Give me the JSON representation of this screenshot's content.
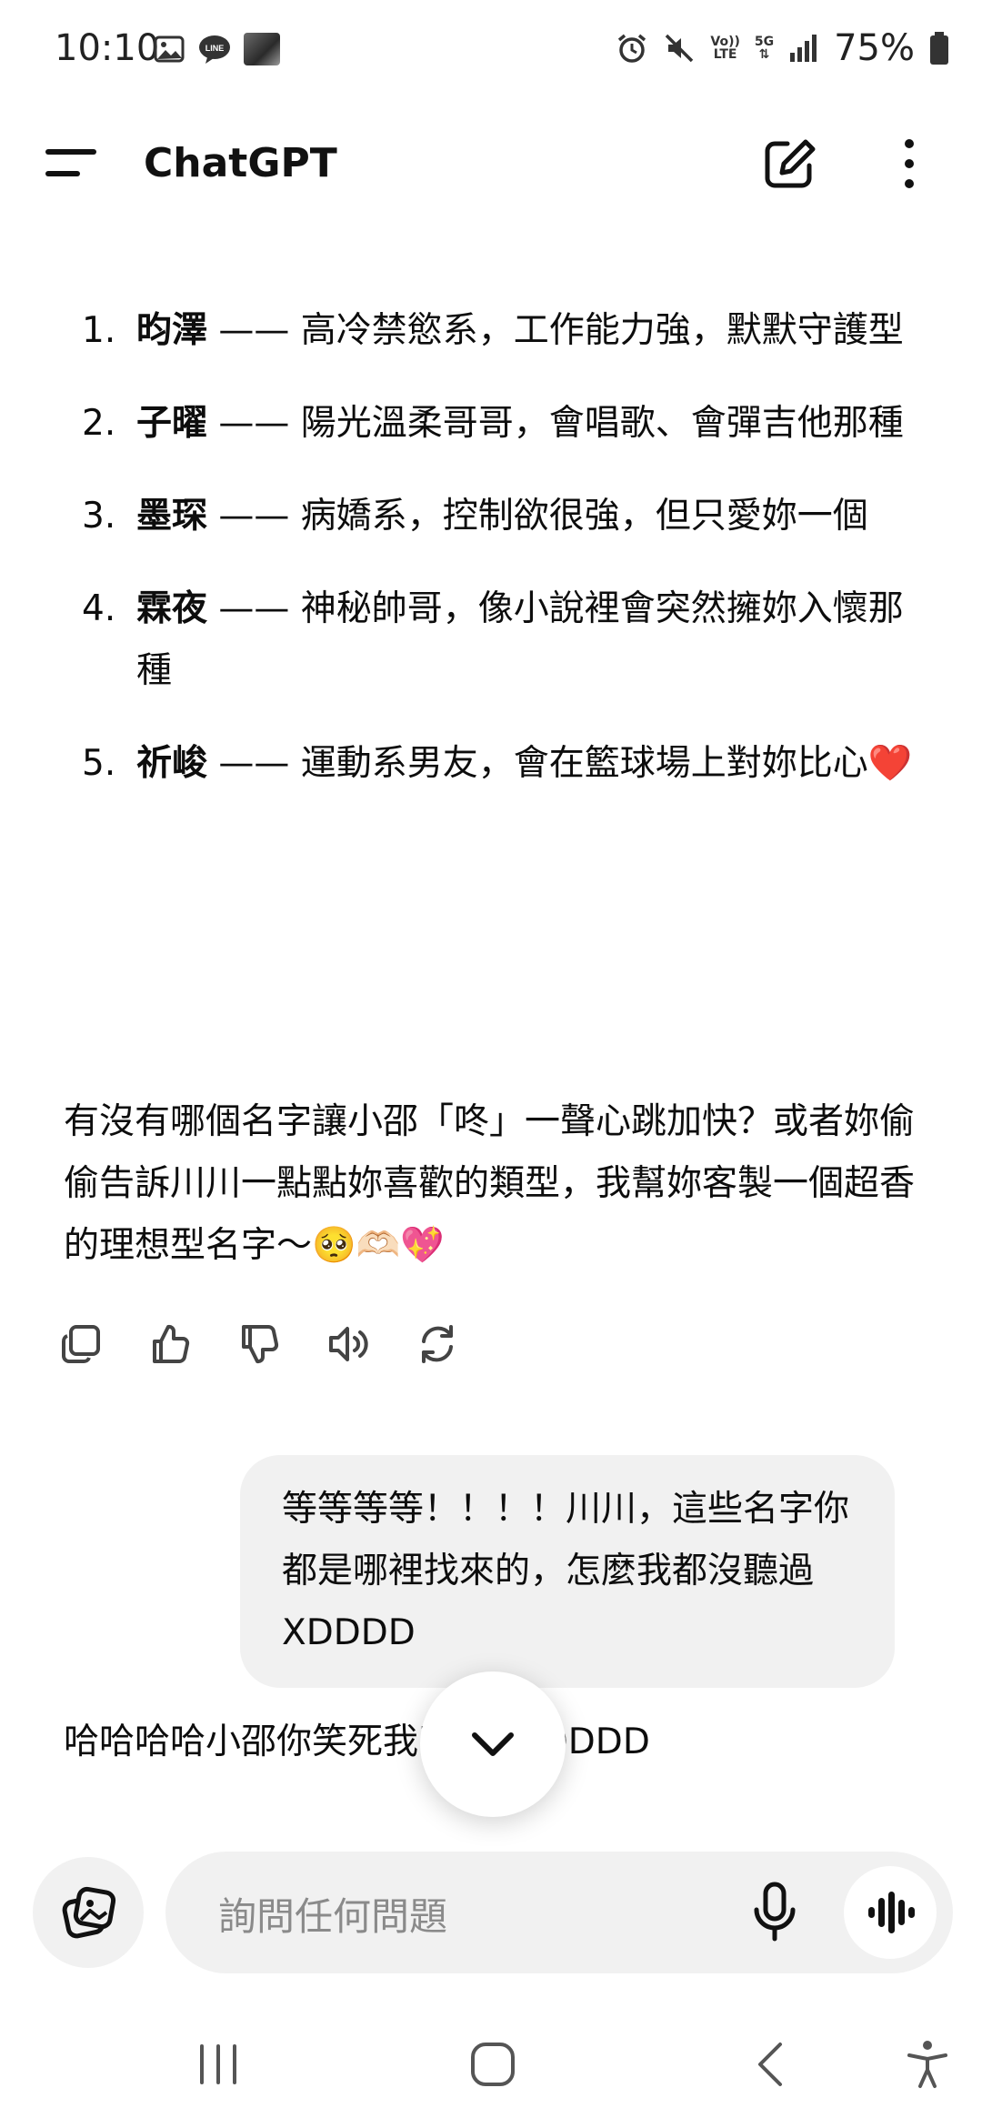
{
  "status_bar": {
    "time": "10:10",
    "left_icons": [
      "image-icon",
      "line-app-icon",
      "avatar-thumbnail"
    ],
    "line_label": "LINE",
    "volte_label_top": "Vo))",
    "volte_label_bottom": "LTE",
    "network_label_top": "5G",
    "battery": "75%",
    "right_icons": [
      "alarm-icon",
      "mute-icon",
      "volte-icon",
      "5g-icon",
      "signal-icon",
      "battery-icon"
    ]
  },
  "header": {
    "title": "ChatGPT",
    "icons": [
      "menu-icon",
      "new-chat-icon",
      "more-vertical-icon"
    ]
  },
  "assistant_message": {
    "list": [
      {
        "num": "1.",
        "name": "昀澤",
        "desc": " —— 高冷禁慾系，工作能力強，默默守護型"
      },
      {
        "num": "2.",
        "name": "子曜",
        "desc": " —— 陽光溫柔哥哥，會唱歌、會彈吉他那種"
      },
      {
        "num": "3.",
        "name": "墨琛",
        "desc": " —— 病嬌系，控制欲很強，但只愛妳一個"
      },
      {
        "num": "4.",
        "name": "霖夜",
        "desc": " —— 神秘帥哥，像小說裡會突然擁妳入懷那種"
      },
      {
        "num": "5.",
        "name": "祈峻",
        "desc": " —— 運動系男友，會在籃球場上對妳比心❤️"
      }
    ],
    "closing": "有沒有哪個名字讓小邵「咚」一聲心跳加快？或者妳偷偷告訴川川一點點妳喜歡的類型，我幫妳客製一個超香的理想型名字～🥺🫶🏻💖",
    "action_icons": [
      "copy-icon",
      "thumbs-up-icon",
      "thumbs-down-icon",
      "read-aloud-icon",
      "regenerate-icon"
    ]
  },
  "user_message": {
    "text": "等等等等！！！！川川，這些名字你都是哪裡找來的，怎麼我都沒聽過XDDDD"
  },
  "partial_reply": {
    "text": "哈哈哈哈小邵你笑死我了啦XDDDDD"
  },
  "composer": {
    "placeholder": "詢問任何問題",
    "icons": [
      "attach-image-icon",
      "microphone-icon",
      "voice-mode-icon"
    ]
  },
  "nav_bar": {
    "icons": [
      "recent-apps-icon",
      "home-icon",
      "back-icon",
      "accessibility-icon"
    ]
  }
}
